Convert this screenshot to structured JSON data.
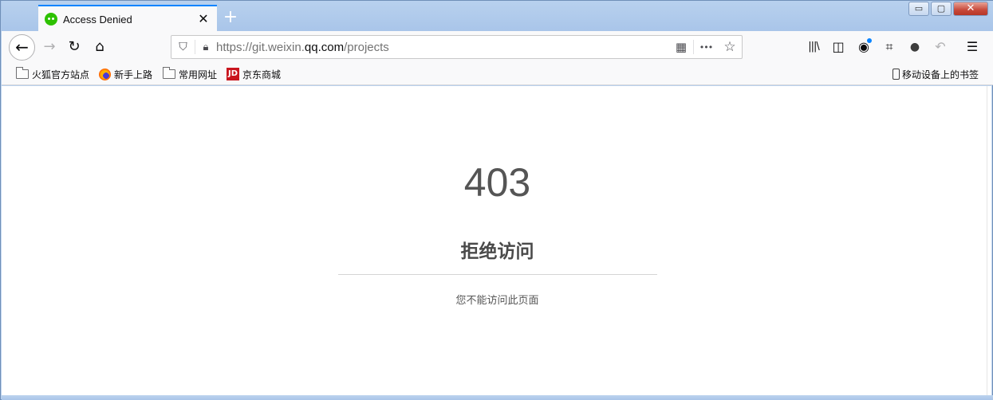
{
  "tab": {
    "title": "Access Denied",
    "close_glyph": "✕",
    "new_tab_glyph": "+"
  },
  "window_controls": {
    "minimize": "▭",
    "maximize": "▢",
    "close": "✕"
  },
  "navbar": {
    "back_glyph": "←",
    "forward_glyph": "→",
    "reload_glyph": "↻",
    "home_glyph": "⌂",
    "url_prefix": "https://git.weixin.",
    "url_domain": "qq.com",
    "url_path": "/projects",
    "qr_glyph": "▦",
    "more_glyph": "•••",
    "star_glyph": "☆",
    "library_glyph": "|||\\",
    "sidebar_glyph": "◫",
    "account_glyph": "◉",
    "crop_glyph": "⌗",
    "chat_glyph": "●",
    "undo_glyph": "↶",
    "menu_glyph": "☰"
  },
  "bookmarks": {
    "items": [
      {
        "label": "火狐官方站点",
        "icon": "folder-icon"
      },
      {
        "label": "新手上路",
        "icon": "firefox-icon"
      },
      {
        "label": "常用网址",
        "icon": "folder-icon"
      },
      {
        "label": "京东商城",
        "icon": "jd-icon"
      }
    ],
    "jd_badge": "JD",
    "mobile": "移动设备上的书签"
  },
  "page": {
    "code": "403",
    "heading": "拒绝访问",
    "message": "您不能访问此页面"
  },
  "colors": {
    "tab_accent": "#0a84ff",
    "wechat_green": "#2dc100",
    "jd_red": "#c9151e"
  }
}
